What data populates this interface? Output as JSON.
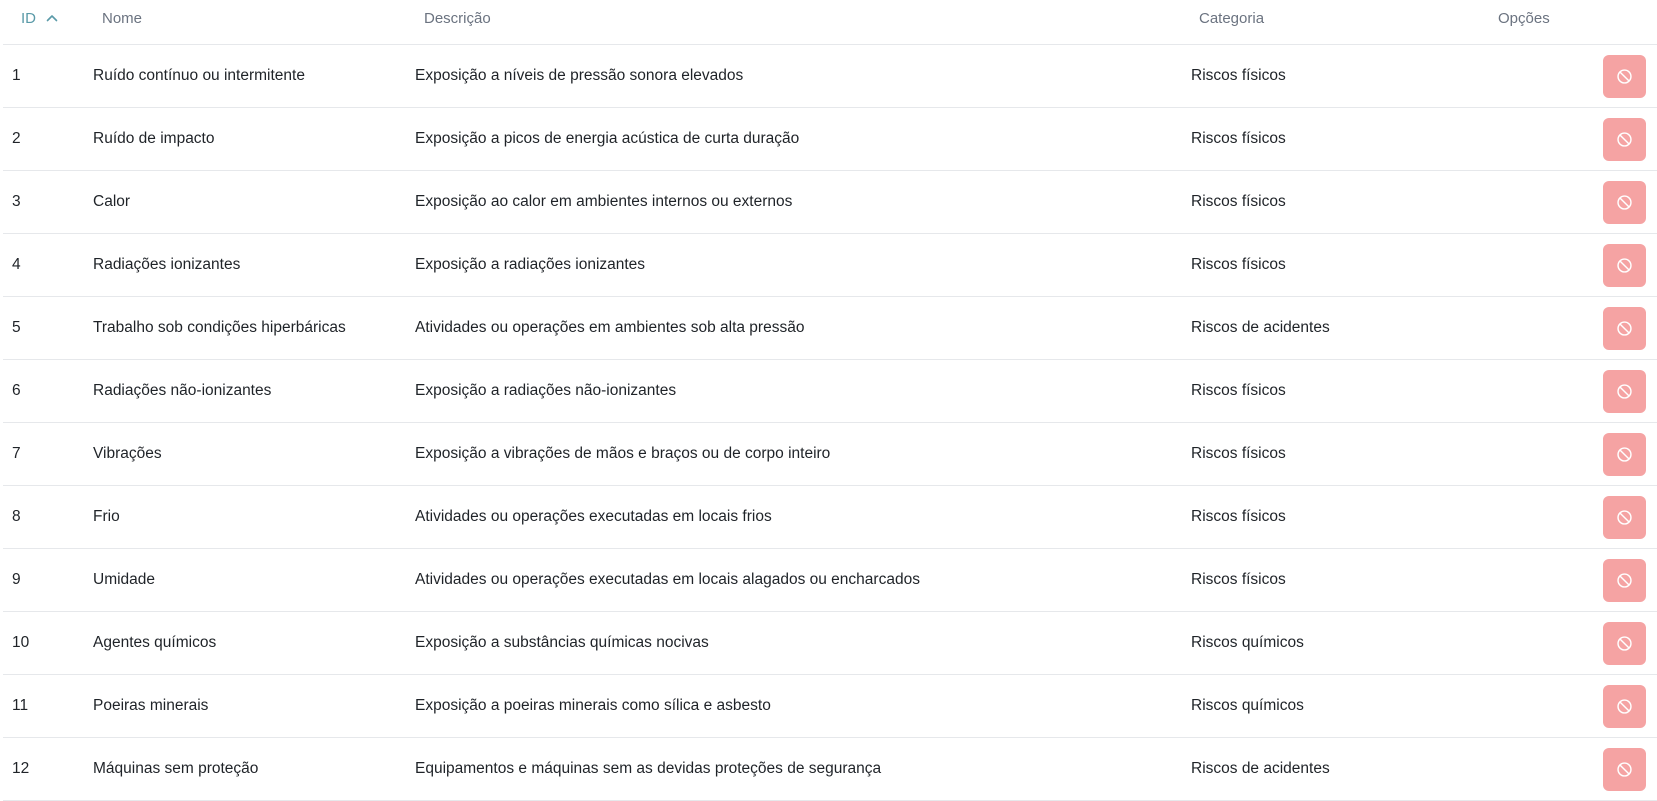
{
  "columns": {
    "id": "ID",
    "nome": "Nome",
    "descricao": "Descrição",
    "categoria": "Categoria",
    "opcoes": "Opções"
  },
  "sort": {
    "column": "ID",
    "direction": "ascending",
    "icon": "chevron-up-icon"
  },
  "colors": {
    "sorted_header": "#5a9aa8",
    "header_text": "#6b7380",
    "disable_button_bg": "#f5a3a3",
    "row_divider": "#e6e8eb"
  },
  "row_action_icon": "ban-icon",
  "rows": [
    {
      "id": "1",
      "nome": "Ruído contínuo ou intermitente",
      "descricao": "Exposição a níveis de pressão sonora elevados",
      "categoria": "Riscos físicos"
    },
    {
      "id": "2",
      "nome": "Ruído de impacto",
      "descricao": "Exposição a picos de energia acústica de curta duração",
      "categoria": "Riscos físicos"
    },
    {
      "id": "3",
      "nome": "Calor",
      "descricao": "Exposição ao calor em ambientes internos ou externos",
      "categoria": "Riscos físicos"
    },
    {
      "id": "4",
      "nome": "Radiações ionizantes",
      "descricao": "Exposição a radiações ionizantes",
      "categoria": "Riscos físicos"
    },
    {
      "id": "5",
      "nome": "Trabalho sob condições hiperbáricas",
      "descricao": "Atividades ou operações em ambientes sob alta pressão",
      "categoria": "Riscos de acidentes"
    },
    {
      "id": "6",
      "nome": "Radiações não-ionizantes",
      "descricao": "Exposição a radiações não-ionizantes",
      "categoria": "Riscos físicos"
    },
    {
      "id": "7",
      "nome": "Vibrações",
      "descricao": "Exposição a vibrações de mãos e braços ou de corpo inteiro",
      "categoria": "Riscos físicos"
    },
    {
      "id": "8",
      "nome": "Frio",
      "descricao": "Atividades ou operações executadas em locais frios",
      "categoria": "Riscos físicos"
    },
    {
      "id": "9",
      "nome": "Umidade",
      "descricao": "Atividades ou operações executadas em locais alagados ou encharcados",
      "categoria": "Riscos físicos"
    },
    {
      "id": "10",
      "nome": "Agentes químicos",
      "descricao": "Exposição a substâncias químicas nocivas",
      "categoria": "Riscos químicos"
    },
    {
      "id": "11",
      "nome": "Poeiras minerais",
      "descricao": "Exposição a poeiras minerais como sílica e asbesto",
      "categoria": "Riscos químicos"
    },
    {
      "id": "12",
      "nome": "Máquinas sem proteção",
      "descricao": "Equipamentos e máquinas sem as devidas proteções de segurança",
      "categoria": "Riscos de acidentes"
    }
  ]
}
